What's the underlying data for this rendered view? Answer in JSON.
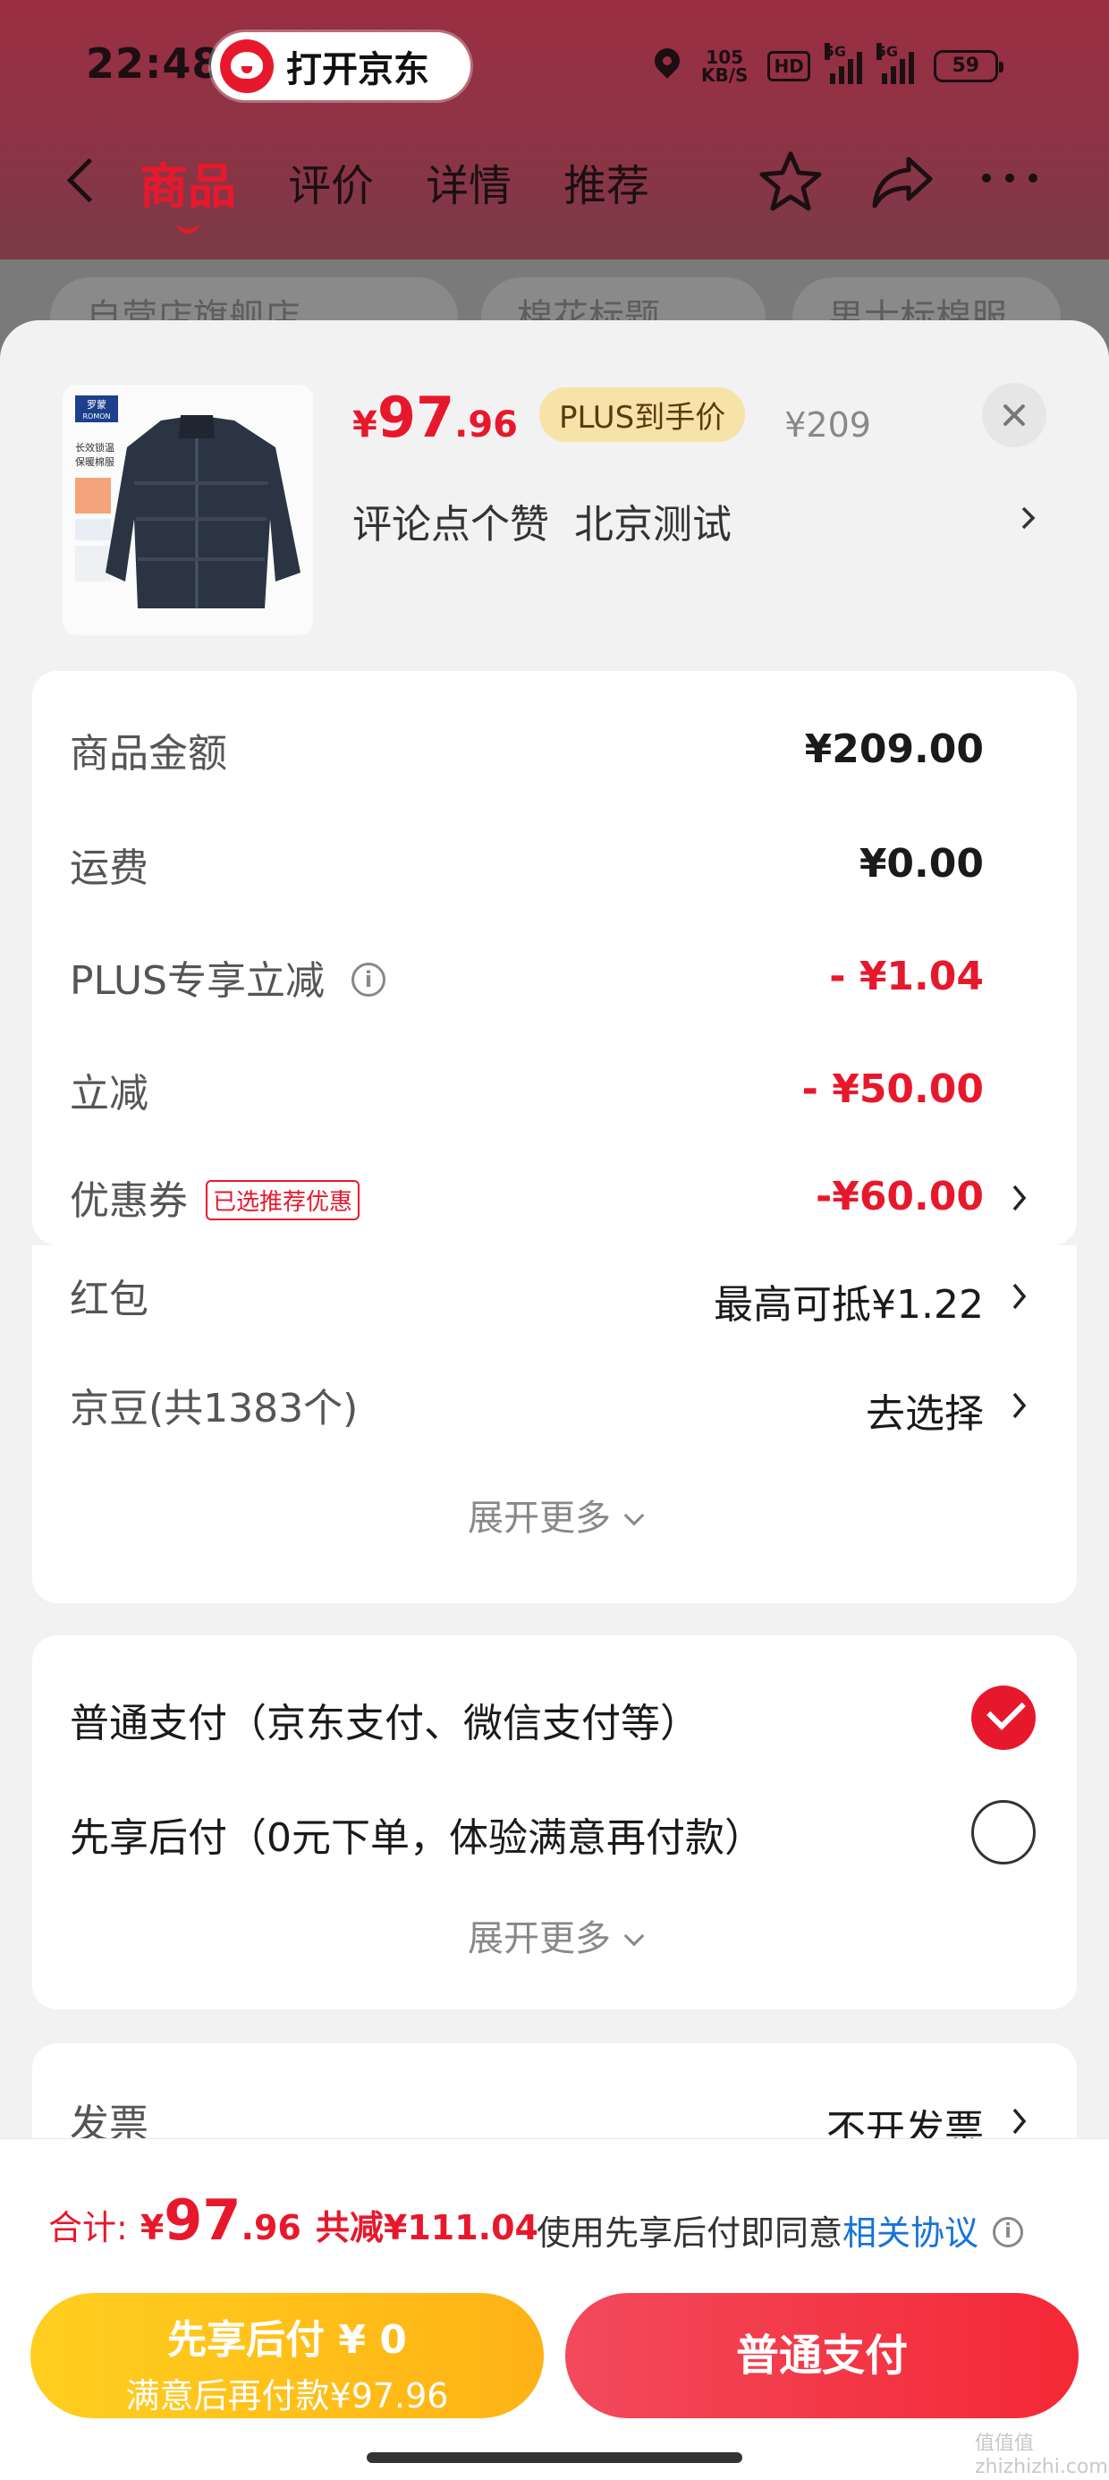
{
  "status_bar": {
    "time": "22:48",
    "speed_value": "105",
    "speed_unit": "KB/S",
    "hd_badge": "HD",
    "signal1_tag": "5G",
    "signal2_tag": "5G",
    "battery": "59"
  },
  "app_pill": {
    "label": "打开京东"
  },
  "nav": {
    "tabs": [
      {
        "label": "商品",
        "active": true
      },
      {
        "label": "评价"
      },
      {
        "label": "详情"
      },
      {
        "label": "推荐"
      }
    ]
  },
  "dim_chips": [
    "自营店旗舰店",
    "棉花标题",
    "男士标棉服"
  ],
  "product": {
    "price_symbol": "¥",
    "price_int": "97",
    "price_dec": ".96",
    "plus_tag": "PLUS到手价",
    "original_price": "¥209",
    "spec_1": "评论点个赞",
    "spec_2": "北京测试",
    "thumb_brand": "罗蒙",
    "thumb_brand_en": "ROMON",
    "thumb_text_1": "长效锁温",
    "thumb_text_2": "保暖棉服"
  },
  "fees": [
    {
      "label": "商品金额",
      "value": "¥209.00",
      "style": "bold"
    },
    {
      "label": "运费",
      "value": "¥0.00",
      "style": "bold"
    },
    {
      "label": "PLUS专享立减",
      "value": "- ¥1.04",
      "style": "red",
      "info": true
    },
    {
      "label": "立减",
      "value": "- ¥50.00",
      "style": "red"
    },
    {
      "label": "优惠券",
      "value": "-¥60.00",
      "style": "red",
      "tag": "已选推荐优惠",
      "chevron": true
    },
    {
      "label": "红包",
      "value": "最高可抵¥1.22",
      "style": "normal",
      "chevron": true
    },
    {
      "label": "京豆(共1383个)",
      "value": "去选择",
      "style": "normal",
      "chevron": true
    }
  ],
  "fees_expand": "展开更多",
  "payment": {
    "options": [
      {
        "label": "普通支付（京东支付、微信支付等）",
        "selected": true
      },
      {
        "label": "先享后付（0元下单，体验满意再付款）",
        "selected": false
      }
    ],
    "expand": "展开更多"
  },
  "invoice": {
    "label": "发票",
    "value": "不开发票"
  },
  "footer": {
    "total_label": "合计:",
    "total_symbol": "¥",
    "total_int": "97",
    "total_dec": ".96",
    "total_discount": "共减¥111.04",
    "agree_prefix": "使用先享后付即同意",
    "agree_link": "相关协议",
    "btn_later_line1": "先享后付 ¥ 0",
    "btn_later_line2": "满意后再付款¥97.96",
    "btn_normal": "普通支付",
    "watermark": "值值值 zhizhizhi.com"
  },
  "colors": {
    "accent_red": "#e8182c",
    "plus_gold": "#f7e3a8",
    "later_yellow": "#ffc01b",
    "link_blue": "#1773d6"
  }
}
